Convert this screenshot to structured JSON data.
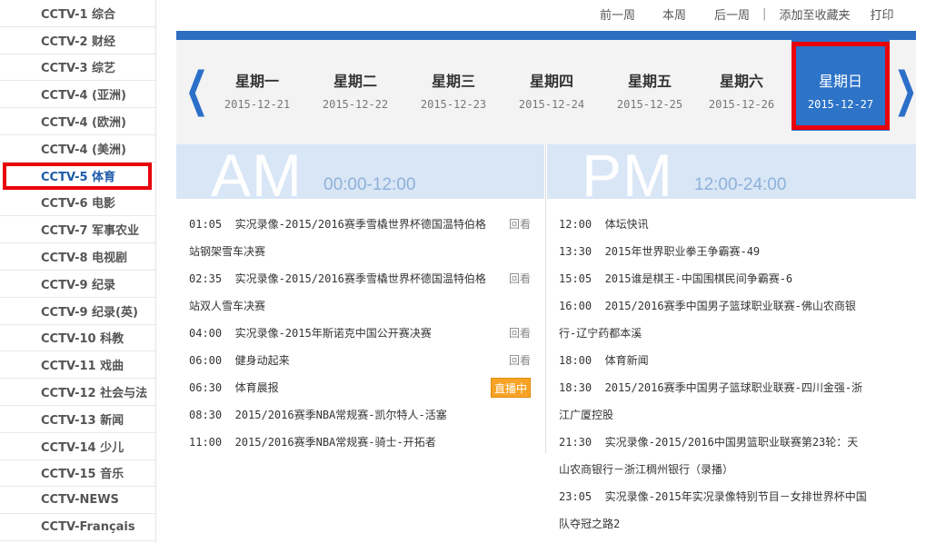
{
  "sidebar": {
    "items": [
      {
        "label": "CCTV-1 综合"
      },
      {
        "label": "CCTV-2 财经"
      },
      {
        "label": "CCTV-3 综艺"
      },
      {
        "label": "CCTV-4 (亚洲)"
      },
      {
        "label": "CCTV-4 (欧洲)"
      },
      {
        "label": "CCTV-4 (美洲)"
      },
      {
        "label": "CCTV-5 体育"
      },
      {
        "label": "CCTV-6 电影"
      },
      {
        "label": "CCTV-7 军事农业"
      },
      {
        "label": "CCTV-8 电视剧"
      },
      {
        "label": "CCTV-9 纪录"
      },
      {
        "label": "CCTV-9 纪录(英)"
      },
      {
        "label": "CCTV-10 科教"
      },
      {
        "label": "CCTV-11 戏曲"
      },
      {
        "label": "CCTV-12 社会与法"
      },
      {
        "label": "CCTV-13 新闻"
      },
      {
        "label": "CCTV-14 少儿"
      },
      {
        "label": "CCTV-15 音乐"
      },
      {
        "label": "CCTV-NEWS"
      },
      {
        "label": "CCTV-Français"
      }
    ],
    "active_index": 6
  },
  "toplinks": {
    "prev_week": "前一周",
    "this_week": "本周",
    "next_week": "后一周",
    "sep": "|",
    "bookmark": "添加至收藏夹",
    "print": "打印"
  },
  "week": {
    "prev_arrow": "❮",
    "next_arrow": "❯",
    "days": [
      {
        "name": "星期一",
        "date": "2015-12-21"
      },
      {
        "name": "星期二",
        "date": "2015-12-22"
      },
      {
        "name": "星期三",
        "date": "2015-12-23"
      },
      {
        "name": "星期四",
        "date": "2015-12-24"
      },
      {
        "name": "星期五",
        "date": "2015-12-25"
      },
      {
        "name": "星期六",
        "date": "2015-12-26"
      },
      {
        "name": "星期日",
        "date": "2015-12-27"
      }
    ],
    "selected_index": 6
  },
  "am": {
    "label": "AM",
    "range": "00:00-12:00"
  },
  "pm": {
    "label": "PM",
    "range": "12:00-24:00"
  },
  "am_programs": [
    {
      "time": "01:05",
      "title": "实况录像-2015/2016赛季雪橇世界杯德国温特伯格站钢架雪车决赛",
      "tag": "回看"
    },
    {
      "time": "02:35",
      "title": "实况录像-2015/2016赛季雪橇世界杯德国温特伯格站双人雪车决赛",
      "tag": "回看"
    },
    {
      "time": "04:00",
      "title": "实况录像-2015年斯诺克中国公开赛决赛",
      "tag": "回看"
    },
    {
      "time": "06:00",
      "title": "健身动起来",
      "tag": "回看"
    },
    {
      "time": "06:30",
      "title": "体育晨报",
      "tag": "直播中"
    },
    {
      "time": "08:30",
      "title": "2015/2016赛季NBA常规赛-凯尔特人-活塞",
      "tag": ""
    },
    {
      "time": "11:00",
      "title": "2015/2016赛季NBA常规赛-骑士-开拓者",
      "tag": ""
    }
  ],
  "pm_programs": [
    {
      "time": "12:00",
      "title": "体坛快讯"
    },
    {
      "time": "13:30",
      "title": "2015年世界职业拳王争霸赛-49"
    },
    {
      "time": "15:05",
      "title": "2015谁是棋王-中国围棋民间争霸赛-6"
    },
    {
      "time": "16:00",
      "title": "2015/2016赛季中国男子篮球职业联赛-佛山农商银行-辽宁药都本溪"
    },
    {
      "time": "18:00",
      "title": "体育新闻"
    },
    {
      "time": "18:30",
      "title": "2015/2016赛季中国男子篮球职业联赛-四川金强-浙江广厦控股"
    },
    {
      "time": "21:30",
      "title": "实况录像-2015/2016中国男篮职业联赛第23轮：天山农商银行－浙江稠州银行（录播）"
    },
    {
      "time": "23:05",
      "title": "实况录像-2015年实况录像特别节目－女排世界杯中国队夺冠之路2"
    }
  ],
  "colors": {
    "accent": "#2d6ec2",
    "highlight": "#e8000b",
    "live": "#f7a325"
  }
}
